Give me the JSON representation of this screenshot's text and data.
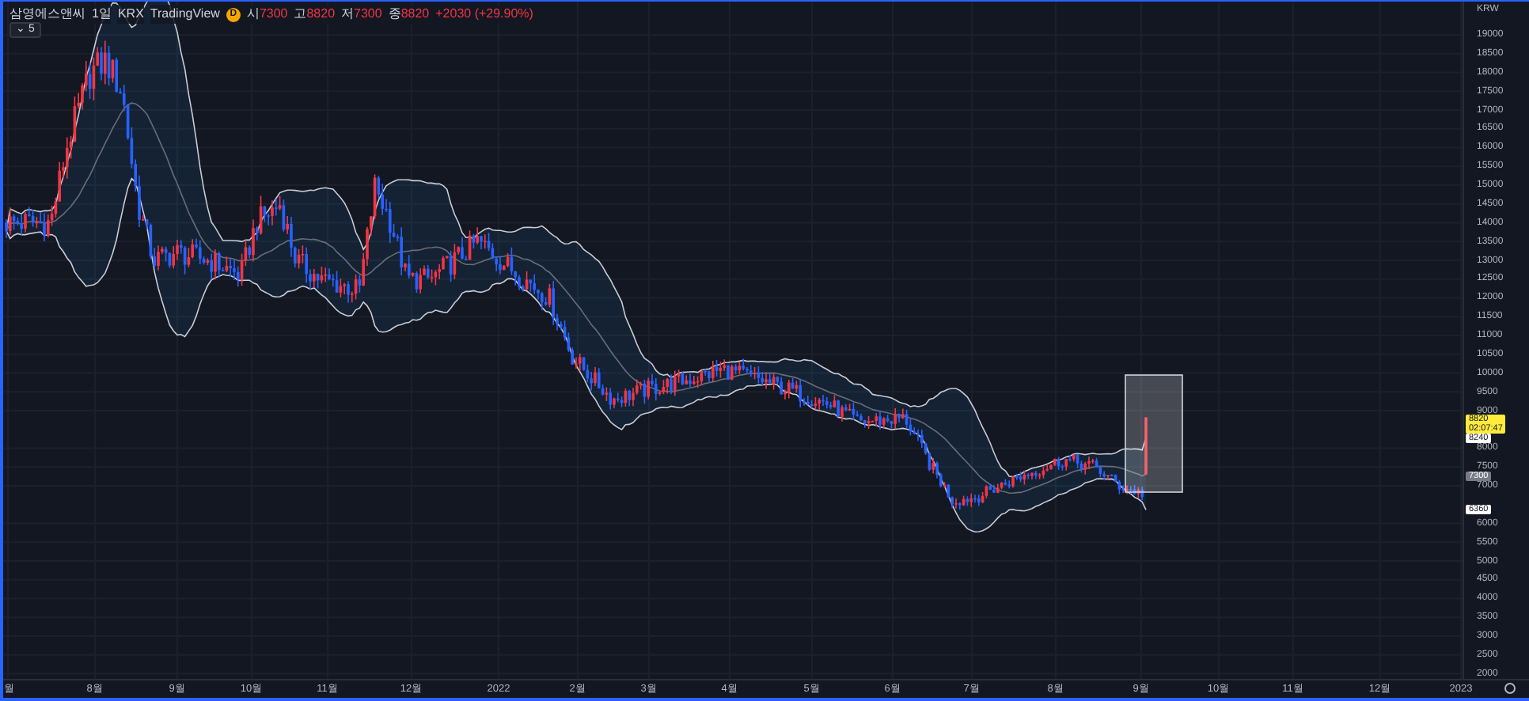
{
  "header": {
    "symbol": "삼영에스앤씨",
    "interval": "1일",
    "exchange": "KRX",
    "source": "TradingView",
    "badge": "D",
    "ohlc": [
      {
        "label": "시",
        "value": "7300"
      },
      {
        "label": "고",
        "value": "8820"
      },
      {
        "label": "저",
        "value": "7300"
      },
      {
        "label": "종",
        "value": "8820"
      }
    ],
    "change": "+2030 (+29.90%)"
  },
  "indicator_toggle": {
    "icon": "⌄",
    "count": "5"
  },
  "price_axis": {
    "currency": "KRW",
    "ticks": [
      "19000",
      "18500",
      "18000",
      "17500",
      "17000",
      "16500",
      "16000",
      "15500",
      "15000",
      "14500",
      "14000",
      "13500",
      "13000",
      "12500",
      "12000",
      "11500",
      "11000",
      "10500",
      "10000",
      "9500",
      "9000",
      "8000",
      "7500",
      "7000",
      "6000",
      "5500",
      "5000",
      "4500",
      "4000",
      "3500",
      "3000",
      "2500",
      "2000"
    ]
  },
  "price_tags": [
    {
      "kind": "last",
      "price": "8820",
      "countdown": "02:07:47"
    },
    {
      "kind": "marker",
      "price": "8240"
    },
    {
      "kind": "crosshair",
      "price": "7300"
    },
    {
      "kind": "marker",
      "price": "6360"
    }
  ],
  "time_axis": {
    "labels": [
      "월",
      "8월",
      "9월",
      "10월",
      "11월",
      "12월",
      "2022",
      "2월",
      "3월",
      "4월",
      "5월",
      "6월",
      "7월",
      "8월",
      "9월",
      "10월",
      "11월",
      "12월",
      "2023"
    ]
  }
}
